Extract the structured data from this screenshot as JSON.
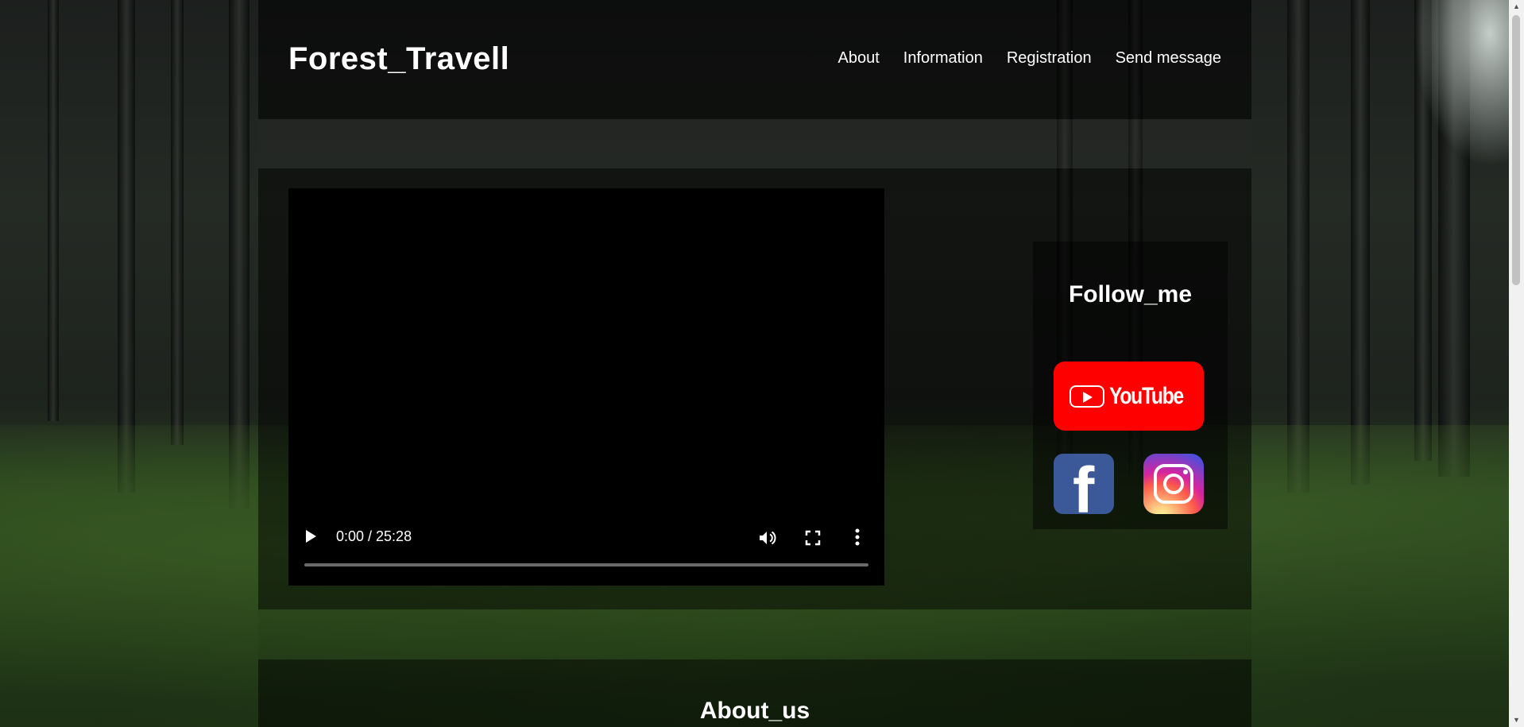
{
  "header": {
    "site_title": "Forest_Travell",
    "nav": [
      "About",
      "Information",
      "Registration",
      "Send message"
    ]
  },
  "video": {
    "time": "0:00 / 25:28",
    "progress": 0
  },
  "follow": {
    "title": "Follow_me",
    "youtube_label": "YouTube",
    "icons": [
      "youtube-icon",
      "facebook-icon",
      "instagram-icon"
    ]
  },
  "about": {
    "title": "About_us"
  },
  "colors": {
    "youtube": "#ff0000",
    "facebook": "#3b5998"
  }
}
